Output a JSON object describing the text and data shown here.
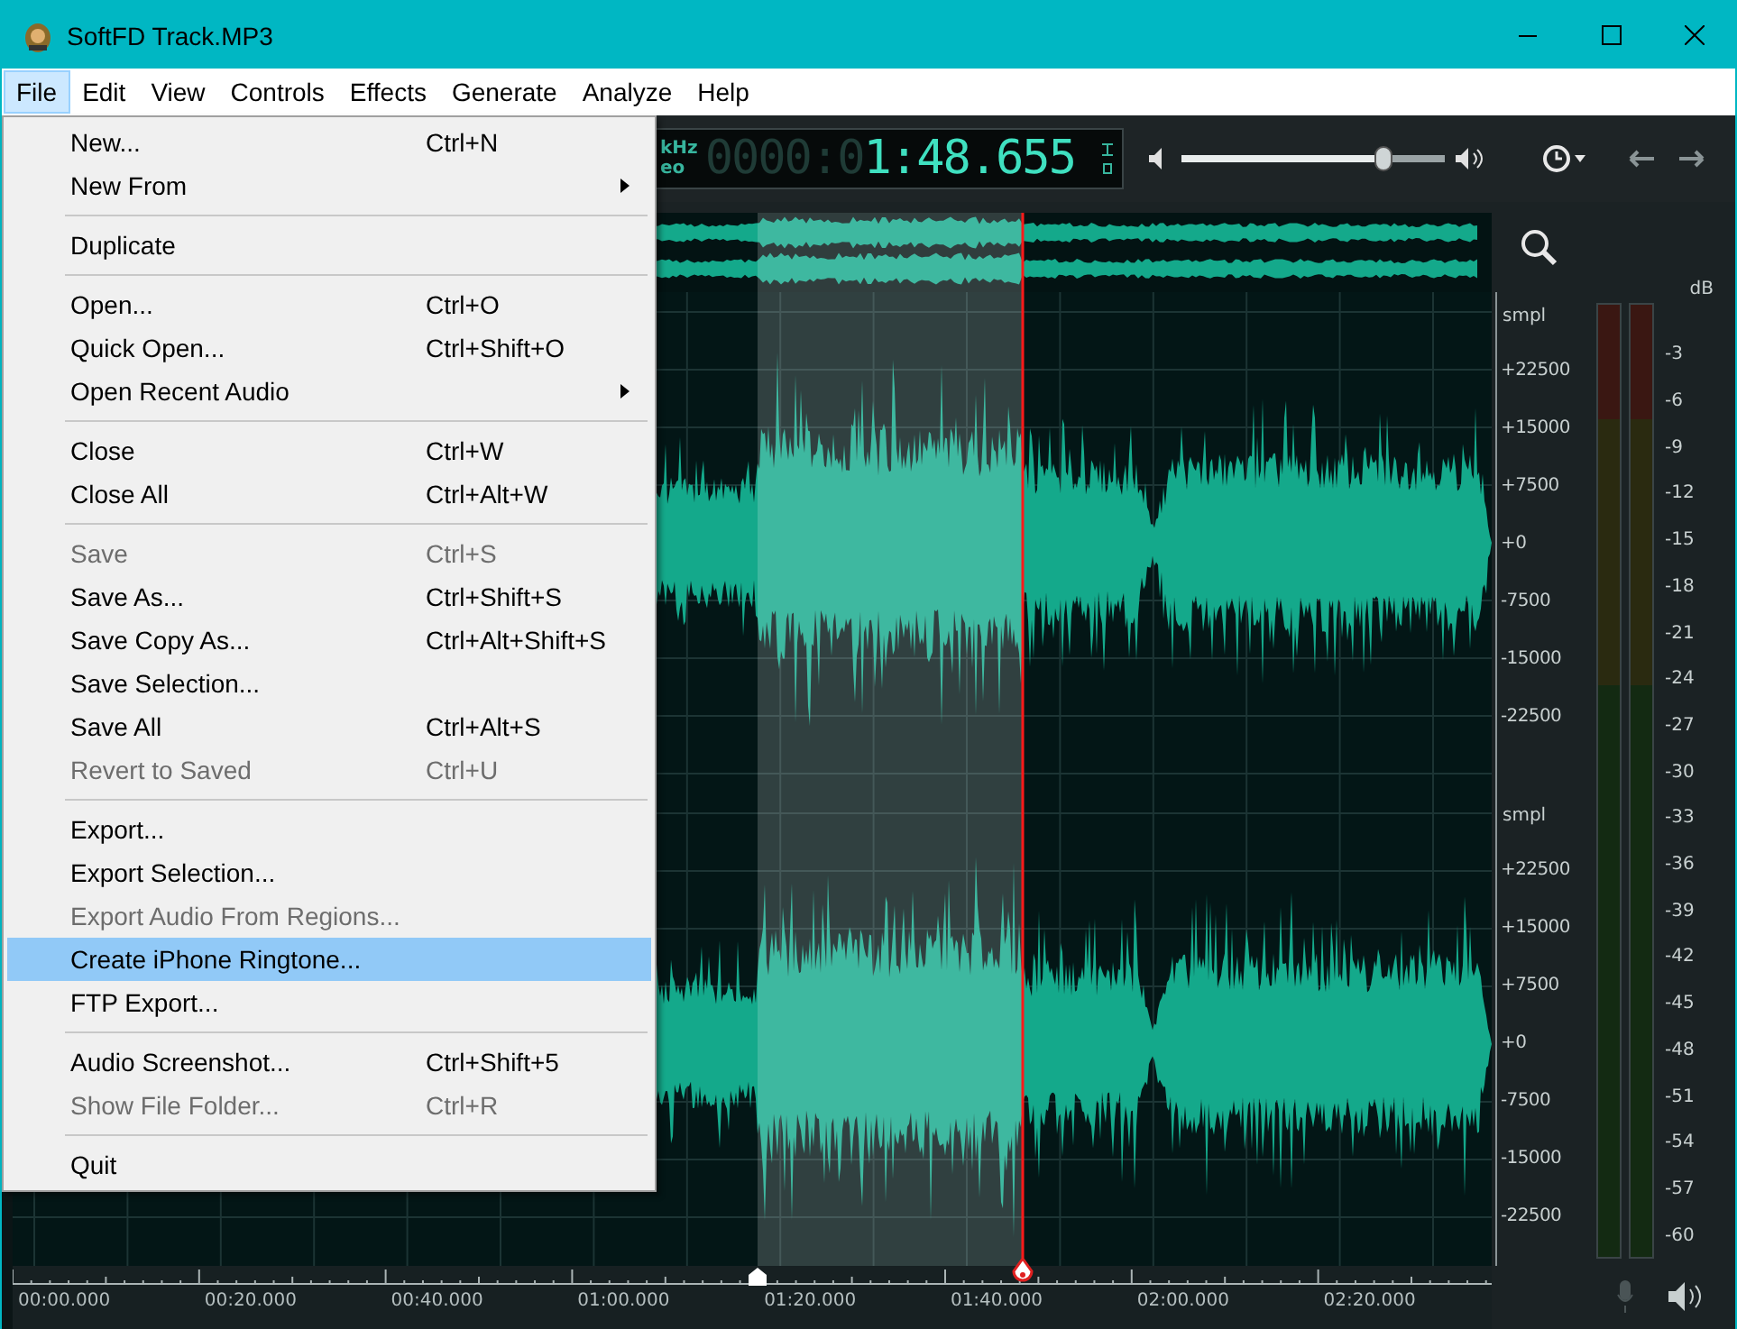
{
  "window": {
    "title": "SoftFD Track.MP3"
  },
  "menubar": [
    {
      "label": "File",
      "selected": true
    },
    {
      "label": "Edit",
      "selected": false
    },
    {
      "label": "View",
      "selected": false
    },
    {
      "label": "Controls",
      "selected": false
    },
    {
      "label": "Effects",
      "selected": false
    },
    {
      "label": "Generate",
      "selected": false
    },
    {
      "label": "Analyze",
      "selected": false
    },
    {
      "label": "Help",
      "selected": false
    }
  ],
  "file_menu": [
    {
      "kind": "item",
      "label": "New...",
      "shortcut": "Ctrl+N",
      "submenu": false,
      "disabled": false,
      "selected": false
    },
    {
      "kind": "item",
      "label": "New From",
      "submenu": true,
      "disabled": false,
      "selected": false
    },
    {
      "kind": "separator"
    },
    {
      "kind": "item",
      "label": "Duplicate",
      "submenu": false,
      "disabled": false,
      "selected": false
    },
    {
      "kind": "separator"
    },
    {
      "kind": "item",
      "label": "Open...",
      "shortcut": "Ctrl+O",
      "submenu": false,
      "disabled": false,
      "selected": false
    },
    {
      "kind": "item",
      "label": "Quick Open...",
      "shortcut": "Ctrl+Shift+O",
      "submenu": false,
      "disabled": false,
      "selected": false
    },
    {
      "kind": "item",
      "label": "Open Recent Audio",
      "submenu": true,
      "disabled": false,
      "selected": false
    },
    {
      "kind": "separator"
    },
    {
      "kind": "item",
      "label": "Close",
      "shortcut": "Ctrl+W",
      "submenu": false,
      "disabled": false,
      "selected": false
    },
    {
      "kind": "item",
      "label": "Close All",
      "shortcut": "Ctrl+Alt+W",
      "submenu": false,
      "disabled": false,
      "selected": false
    },
    {
      "kind": "separator"
    },
    {
      "kind": "item",
      "label": "Save",
      "shortcut": "Ctrl+S",
      "submenu": false,
      "disabled": true,
      "selected": false
    },
    {
      "kind": "item",
      "label": "Save As...",
      "shortcut": "Ctrl+Shift+S",
      "submenu": false,
      "disabled": false,
      "selected": false
    },
    {
      "kind": "item",
      "label": "Save Copy As...",
      "shortcut": "Ctrl+Alt+Shift+S",
      "submenu": false,
      "disabled": false,
      "selected": false
    },
    {
      "kind": "item",
      "label": "Save Selection...",
      "submenu": false,
      "disabled": false,
      "selected": false
    },
    {
      "kind": "item",
      "label": "Save All",
      "shortcut": "Ctrl+Alt+S",
      "submenu": false,
      "disabled": false,
      "selected": false
    },
    {
      "kind": "item",
      "label": "Revert to Saved",
      "shortcut": "Ctrl+U",
      "submenu": false,
      "disabled": true,
      "selected": false
    },
    {
      "kind": "separator"
    },
    {
      "kind": "item",
      "label": "Export...",
      "submenu": false,
      "disabled": false,
      "selected": false
    },
    {
      "kind": "item",
      "label": "Export Selection...",
      "submenu": false,
      "disabled": false,
      "selected": false
    },
    {
      "kind": "item",
      "label": "Export Audio From Regions...",
      "submenu": false,
      "disabled": true,
      "selected": false
    },
    {
      "kind": "item",
      "label": "Create iPhone Ringtone...",
      "submenu": false,
      "disabled": false,
      "selected": true
    },
    {
      "kind": "item",
      "label": "FTP Export...",
      "submenu": false,
      "disabled": false,
      "selected": false
    },
    {
      "kind": "separator"
    },
    {
      "kind": "item",
      "label": "Audio Screenshot...",
      "shortcut": "Ctrl+Shift+5",
      "submenu": false,
      "disabled": false,
      "selected": false
    },
    {
      "kind": "item",
      "label": "Show File Folder...",
      "shortcut": "Ctrl+R",
      "submenu": false,
      "disabled": true,
      "selected": false
    },
    {
      "kind": "separator"
    },
    {
      "kind": "item",
      "label": "Quit",
      "submenu": false,
      "disabled": false,
      "selected": false
    }
  ],
  "toolbar": {
    "rate_unit": "kHz",
    "channel_mode": "eo",
    "time_dim": "0000:0",
    "time": "1:48.655",
    "volume": {
      "level": 0.77
    }
  },
  "scale": [
    {
      "unit": "smpl",
      "ticks": [
        "+22500",
        "+15000",
        "+7500",
        "+0",
        "-7500",
        "-15000",
        "-22500"
      ]
    },
    {
      "unit": "smpl",
      "ticks": [
        "+22500",
        "+15000",
        "+7500",
        "+0",
        "-7500",
        "-15000",
        "-22500"
      ]
    }
  ],
  "meter": {
    "unit": "dB",
    "ticks": [
      "-3",
      "-6",
      "-9",
      "-12",
      "-15",
      "-18",
      "-21",
      "-24",
      "-27",
      "-30",
      "-33",
      "-36",
      "-39",
      "-42",
      "-45",
      "-48",
      "-51",
      "-54",
      "-57",
      "-60"
    ]
  },
  "timeline": [
    "00:00.000",
    "00:20.000",
    "00:40.000",
    "01:00.000",
    "01:20.000",
    "01:40.000",
    "02:00.000",
    "02:20.000"
  ]
}
